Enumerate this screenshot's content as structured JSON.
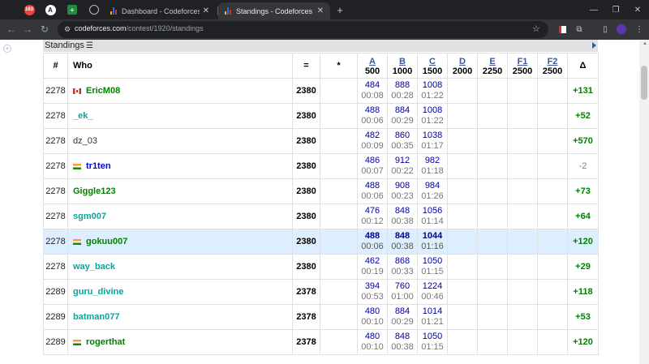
{
  "browser": {
    "pinned_tabs": [
      {
        "name": "pinned-tab-mail",
        "icon": "badge-icon",
        "label": "163"
      },
      {
        "name": "pinned-tab-a",
        "icon": "letter-a-icon",
        "label": "A"
      },
      {
        "name": "pinned-tab-sheets",
        "icon": "sheets-icon",
        "label": "+"
      },
      {
        "name": "pinned-tab-globe",
        "icon": "globe-icon",
        "label": ""
      }
    ],
    "tabs": [
      {
        "title": "Dashboard - Codeforces Round",
        "active": false
      },
      {
        "title": "Standings - Codeforces Round",
        "active": true
      }
    ],
    "url_domain": "codeforces.com",
    "url_path": "/contest/1920/standings"
  },
  "standings": {
    "title": "Standings",
    "columns": {
      "rank": "#",
      "who": "Who",
      "points": "=",
      "penalty": "*",
      "delta": "Δ"
    },
    "problems": [
      {
        "letter": "A",
        "points": "500"
      },
      {
        "letter": "B",
        "points": "1000"
      },
      {
        "letter": "C",
        "points": "1500"
      },
      {
        "letter": "D",
        "points": "2000"
      },
      {
        "letter": "E",
        "points": "2250"
      },
      {
        "letter": "F1",
        "points": "2500"
      },
      {
        "letter": "F2",
        "points": "2500"
      }
    ],
    "rows": [
      {
        "rank": "2278",
        "flag": "ca",
        "handle": "EricM08",
        "color": "green",
        "points": "2380",
        "penalty": "",
        "results": [
          [
            "484",
            "00:08"
          ],
          [
            "888",
            "00:28"
          ],
          [
            "1008",
            "01:22"
          ],
          [
            "",
            ""
          ],
          [
            "",
            ""
          ],
          [
            "",
            ""
          ],
          [
            "",
            ""
          ]
        ],
        "delta": "+131",
        "highlight": false
      },
      {
        "rank": "2278",
        "flag": "",
        "handle": "_ek_",
        "color": "cyan",
        "points": "2380",
        "penalty": "",
        "results": [
          [
            "488",
            "00:06"
          ],
          [
            "884",
            "00:29"
          ],
          [
            "1008",
            "01:22"
          ],
          [
            "",
            ""
          ],
          [
            "",
            ""
          ],
          [
            "",
            ""
          ],
          [
            "",
            ""
          ]
        ],
        "delta": "+52",
        "highlight": false
      },
      {
        "rank": "2278",
        "flag": "",
        "handle": "dz_03",
        "color": "gray",
        "points": "2380",
        "penalty": "",
        "results": [
          [
            "482",
            "00:09"
          ],
          [
            "860",
            "00:35"
          ],
          [
            "1038",
            "01:17"
          ],
          [
            "",
            ""
          ],
          [
            "",
            ""
          ],
          [
            "",
            ""
          ],
          [
            "",
            ""
          ]
        ],
        "delta": "+570",
        "highlight": false
      },
      {
        "rank": "2278",
        "flag": "in",
        "handle": "tr1ten",
        "color": "blue",
        "points": "2380",
        "penalty": "",
        "results": [
          [
            "486",
            "00:07"
          ],
          [
            "912",
            "00:22"
          ],
          [
            "982",
            "01:18"
          ],
          [
            "",
            ""
          ],
          [
            "",
            ""
          ],
          [
            "",
            ""
          ],
          [
            "",
            ""
          ]
        ],
        "delta": "-2",
        "highlight": false
      },
      {
        "rank": "2278",
        "flag": "",
        "handle": "Giggle123",
        "color": "green",
        "points": "2380",
        "penalty": "",
        "results": [
          [
            "488",
            "00:06"
          ],
          [
            "908",
            "00:23"
          ],
          [
            "984",
            "01:26"
          ],
          [
            "",
            ""
          ],
          [
            "",
            ""
          ],
          [
            "",
            ""
          ],
          [
            "",
            ""
          ]
        ],
        "delta": "+73",
        "highlight": false
      },
      {
        "rank": "2278",
        "flag": "",
        "handle": "sgm007",
        "color": "cyan",
        "points": "2380",
        "penalty": "",
        "results": [
          [
            "476",
            "00:12"
          ],
          [
            "848",
            "00:38"
          ],
          [
            "1056",
            "01:14"
          ],
          [
            "",
            ""
          ],
          [
            "",
            ""
          ],
          [
            "",
            ""
          ],
          [
            "",
            ""
          ]
        ],
        "delta": "+64",
        "highlight": false
      },
      {
        "rank": "2278",
        "flag": "in",
        "handle": "gokuu007",
        "color": "green",
        "points": "2380",
        "penalty": "",
        "results": [
          [
            "488",
            "00:06"
          ],
          [
            "848",
            "00:38"
          ],
          [
            "1044",
            "01:16"
          ],
          [
            "",
            ""
          ],
          [
            "",
            ""
          ],
          [
            "",
            ""
          ],
          [
            "",
            ""
          ]
        ],
        "delta": "+120",
        "highlight": true
      },
      {
        "rank": "2278",
        "flag": "",
        "handle": "way_back",
        "color": "cyan",
        "points": "2380",
        "penalty": "",
        "results": [
          [
            "462",
            "00:19"
          ],
          [
            "868",
            "00:33"
          ],
          [
            "1050",
            "01:15"
          ],
          [
            "",
            ""
          ],
          [
            "",
            ""
          ],
          [
            "",
            ""
          ],
          [
            "",
            ""
          ]
        ],
        "delta": "+29",
        "highlight": false
      },
      {
        "rank": "2289",
        "flag": "",
        "handle": "guru_divine",
        "color": "cyan",
        "points": "2378",
        "penalty": "",
        "results": [
          [
            "394",
            "00:53"
          ],
          [
            "760",
            "01:00"
          ],
          [
            "1224",
            "00:46"
          ],
          [
            "",
            ""
          ],
          [
            "",
            ""
          ],
          [
            "",
            ""
          ],
          [
            "",
            ""
          ]
        ],
        "delta": "+118",
        "highlight": false
      },
      {
        "rank": "2289",
        "flag": "",
        "handle": "batman077",
        "color": "cyan",
        "points": "2378",
        "penalty": "",
        "results": [
          [
            "480",
            "00:10"
          ],
          [
            "884",
            "00:29"
          ],
          [
            "1014",
            "01:21"
          ],
          [
            "",
            ""
          ],
          [
            "",
            ""
          ],
          [
            "",
            ""
          ],
          [
            "",
            ""
          ]
        ],
        "delta": "+53",
        "highlight": false
      },
      {
        "rank": "2289",
        "flag": "in",
        "handle": "rogerthat",
        "color": "green",
        "points": "2378",
        "penalty": "",
        "results": [
          [
            "480",
            "00:10"
          ],
          [
            "848",
            "00:38"
          ],
          [
            "1050",
            "01:15"
          ],
          [
            "",
            ""
          ],
          [
            "",
            ""
          ],
          [
            "",
            ""
          ],
          [
            "",
            ""
          ]
        ],
        "delta": "+120",
        "highlight": false
      }
    ]
  }
}
